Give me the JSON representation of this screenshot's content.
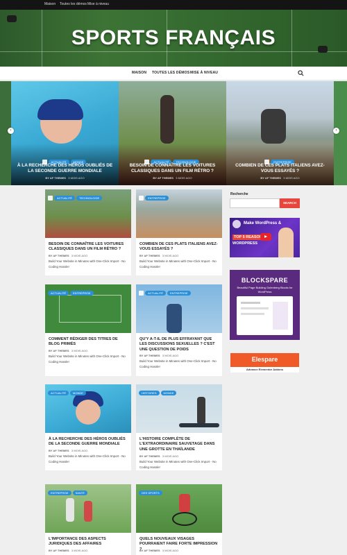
{
  "topbar": {
    "links": [
      "Maison",
      "Toutes les démos",
      "Mise à niveau"
    ]
  },
  "site": {
    "title": "SPORTS FRANÇAIS"
  },
  "nav": {
    "items": [
      "MAISON",
      "TOUTES LES DÉMOS",
      "MISE À NIVEAU"
    ],
    "search_icon": "search-icon"
  },
  "slider": {
    "slides": [
      {
        "cats": [
          "ACTUALITÉ",
          "MONDE"
        ],
        "title": "À LA RECHERCHE DES HÉROS OUBLIÉS DE LA SECONDE GUERRE MONDIALE",
        "author": "BY AF THEMES",
        "date": "3 MOIS AGO"
      },
      {
        "cats": [
          "ACTUALITÉ",
          "TECHNOLOGIE"
        ],
        "title": "BESOIN DE CONNAÎTRE LES VOITURES CLASSIQUES DANS UN FILM RÉTRO ?",
        "author": "BY AF THEMES",
        "date": "3 MOIS AGO"
      },
      {
        "cats": [
          "ENTREPRISE"
        ],
        "title": "COMBIEN DE CES PLATS ITALIENS AVEZ-VOUS ESSAYÉS ?",
        "author": "BY AF THEMES",
        "date": "3 MOIS AGO"
      }
    ]
  },
  "cards": [
    {
      "cats": [
        "ACTUALITÉ",
        "TECHNOLOGIE"
      ],
      "title": "BESOIN DE CONNAÎTRE LES VOITURES CLASSIQUES DANS UN FILM RÉTRO ?",
      "author": "BY AF THEMES",
      "date": "3 MOIS AGO",
      "excerpt": "Build Your Website in Minutes with One-Click Import - No Coding Hassle!"
    },
    {
      "cats": [
        "ENTREPRISE"
      ],
      "title": "COMBIEN DE CES PLATS ITALIENS AVEZ-VOUS ESSAYÉS ?",
      "author": "BY AF THEMES",
      "date": "3 MOIS AGO",
      "excerpt": "Build Your Website in Minutes with One-Click Import - No Coding Hassle!"
    },
    {
      "cats": [
        "ACTUALITÉ",
        "ENTREPRISE"
      ],
      "title": "COMMENT RÉDIGER DES TITRES DE BLOG PRIMÉS",
      "author": "BY AF THEMES",
      "date": "3 MOIS AGO",
      "excerpt": "Build Your Website in Minutes with One-Click Import - No Coding Hassle!"
    },
    {
      "cats": [
        "ACTUALITÉ",
        "ENTREPRISE"
      ],
      "title": "QU'Y A-T-IL DE PLUS EFFRAYANT QUE LES DISCUSSIONS SEXUELLES ? C'EST UNE QUESTION DE POIDS",
      "author": "BY AF THEMES",
      "date": "3 MOIS AGO",
      "excerpt": "Build Your Website in Minutes with One-Click Import - No Coding Hassle!"
    },
    {
      "cats": [
        "ACTUALITÉ",
        "MONDE"
      ],
      "title": "À LA RECHERCHE DES HÉROS OUBLIÉS DE LA SECONDE GUERRE MONDIALE",
      "author": "BY AF THEMES",
      "date": "3 MOIS AGO",
      "excerpt": "Build Your Website in Minutes with One-Click Import - No Coding Hassle!"
    },
    {
      "cats": [
        "HISTOIRES",
        "MONDE"
      ],
      "title": "L'HISTOIRE COMPLÈTE DE L'EXTRAORDINAIRE SAUVETAGE DANS UNE GROTTE EN THAÏLANDE",
      "author": "BY AF THEMES",
      "date": "3 MOIS AGO",
      "excerpt": "Build Your Website in Minutes with One-Click Import - No Coding Hassle!"
    },
    {
      "cats": [
        "ENTREPRISE",
        "SANTÉ"
      ],
      "title": "L'IMPORTANCE DES ASPECTS JURIDIQUES DES AFFAIRES",
      "author": "BY AF THEMES",
      "date": "3 MOIS AGO",
      "excerpt": ""
    },
    {
      "cats": [
        "DES SPORTS"
      ],
      "title": "QUELS NOUVEAUX VISAGES POURRAIENT FAIRE FORTE IMPRESSION ?",
      "author": "BY AF THEMES",
      "date": "3 MOIS AGO",
      "excerpt": ""
    }
  ],
  "sidebar": {
    "search_label": "Recherche",
    "search_placeholder": "",
    "search_button": "SEARCH",
    "ad1": {
      "line1": "Make WordPress &",
      "line2": "TOP 5 REASONS",
      "line3": "WORDPRESS"
    },
    "ad2": {
      "title": "BLOCKSPARE",
      "subtitle": "Beautiful Page Building Gutenberg Blocks for WordPress"
    },
    "ad3": {
      "title": "Elespare",
      "subtitle": "Advance Elementor Addons"
    }
  },
  "colors": {
    "accent": "#2a8fd6",
    "search_button": "#e8453c",
    "topbar": "#141414"
  }
}
